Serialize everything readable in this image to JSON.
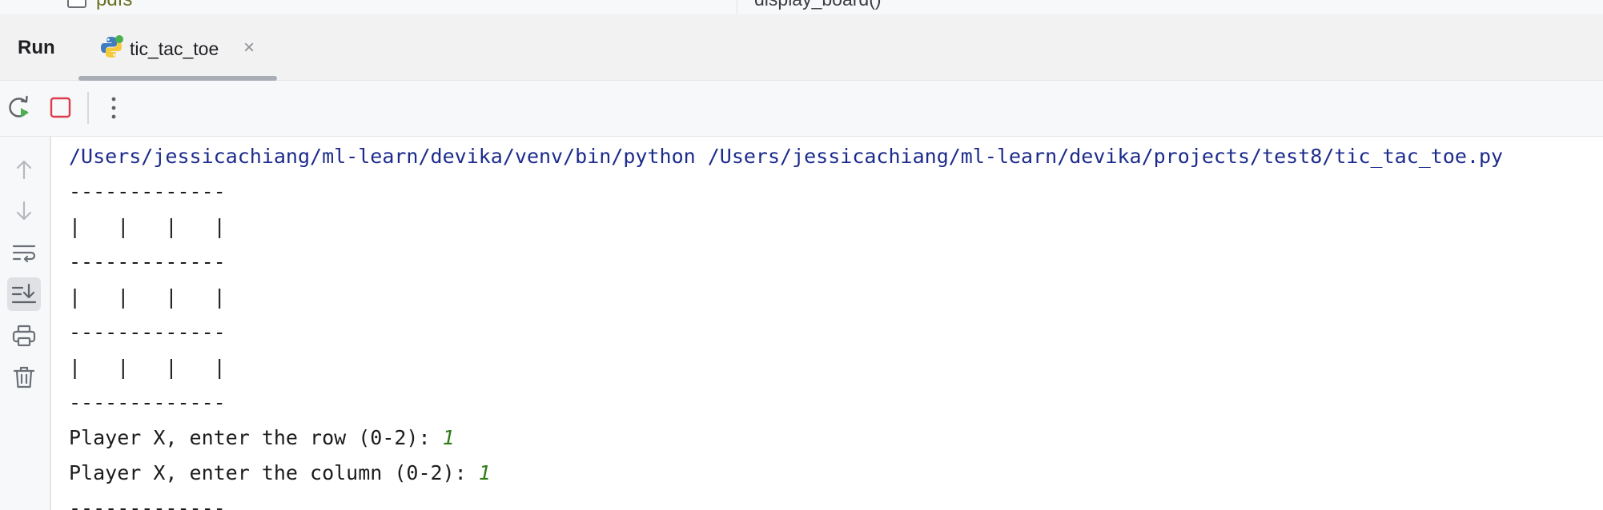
{
  "editor_strip": {
    "folder_label": "pdfs",
    "code_fragment": "display_board()"
  },
  "run_window": {
    "title": "Run",
    "tab": {
      "label": "tic_tac_toe",
      "close_glyph": "×",
      "icon": "python-icon"
    }
  },
  "toolbar": {
    "buttons": [
      {
        "name": "rerun",
        "icon": "rerun-icon"
      },
      {
        "name": "stop",
        "icon": "stop-icon",
        "color": "#db3b4b"
      },
      {
        "name": "more",
        "icon": "more-vertical-icon"
      }
    ]
  },
  "gutter": {
    "buttons": [
      {
        "name": "up-stack-trace",
        "icon": "arrow-up-icon"
      },
      {
        "name": "down-stack-trace",
        "icon": "arrow-down-icon"
      },
      {
        "name": "soft-wrap",
        "icon": "soft-wrap-icon"
      },
      {
        "name": "scroll-to-end",
        "icon": "scroll-to-end-icon",
        "active": true
      },
      {
        "name": "print",
        "icon": "print-icon"
      },
      {
        "name": "clear-all",
        "icon": "trash-icon"
      }
    ]
  },
  "console": {
    "command": "/Users/jessicachiang/ml-learn/devika/venv/bin/python /Users/jessicachiang/ml-learn/devika/projects/test8/tic_tac_toe.py",
    "board_lines": [
      "-------------",
      "|   |   |   |",
      "-------------",
      "|   |   |   |",
      "-------------",
      "|   |   |   |",
      "-------------"
    ],
    "prompt_row": "Player X, enter the row (0-2): ",
    "input_row": "1",
    "prompt_col": "Player X, enter the column (0-2): ",
    "input_col": "1",
    "trailing_line": "-------------"
  },
  "colors": {
    "command_text": "#1c2b8c",
    "user_input": "#2e7d16",
    "stop_red": "#db3b4b"
  }
}
